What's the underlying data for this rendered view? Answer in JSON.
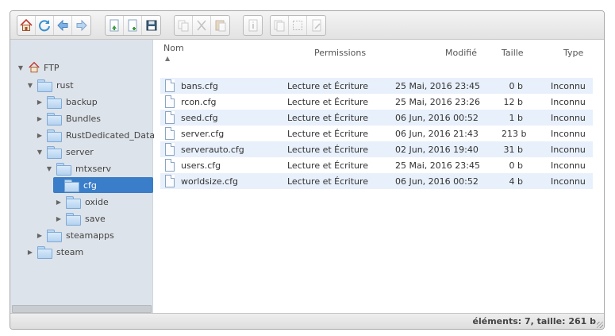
{
  "toolbar": {
    "groups": [
      [
        "home-icon",
        "reload-icon",
        "back-icon",
        "forward-icon"
      ],
      [
        "upload-icon",
        "new-file-icon",
        "save-icon"
      ],
      [
        "copy-icon",
        "cut-icon",
        "paste-icon"
      ],
      [
        "info-icon"
      ],
      [
        "duplicate-icon",
        "select-all-icon",
        "rename-icon"
      ]
    ]
  },
  "tree": {
    "root": "FTP",
    "rust": "rust",
    "backup": "backup",
    "bundles": "Bundles",
    "rustdedicated": "RustDedicated_Data",
    "server": "server",
    "mtxserv": "mtxserv",
    "cfg": "cfg",
    "oxide": "oxide",
    "save": "save",
    "steamapps": "steamapps",
    "steam": "steam"
  },
  "columns": {
    "name": "Nom",
    "permissions": "Permissions",
    "modified": "Modifié",
    "size": "Taille",
    "type": "Type"
  },
  "files": [
    {
      "name": "bans.cfg",
      "perm": "Lecture et Écriture",
      "date": "25 Mai, 2016 23:45",
      "size": "0 b",
      "type": "Inconnu"
    },
    {
      "name": "rcon.cfg",
      "perm": "Lecture et Écriture",
      "date": "25 Mai, 2016 23:26",
      "size": "12 b",
      "type": "Inconnu"
    },
    {
      "name": "seed.cfg",
      "perm": "Lecture et Écriture",
      "date": "06 Jun, 2016 00:52",
      "size": "1 b",
      "type": "Inconnu"
    },
    {
      "name": "server.cfg",
      "perm": "Lecture et Écriture",
      "date": "06 Jun, 2016 21:43",
      "size": "213 b",
      "type": "Inconnu"
    },
    {
      "name": "serverauto.cfg",
      "perm": "Lecture et Écriture",
      "date": "02 Jun, 2016 19:40",
      "size": "31 b",
      "type": "Inconnu"
    },
    {
      "name": "users.cfg",
      "perm": "Lecture et Écriture",
      "date": "25 Mai, 2016 23:45",
      "size": "0 b",
      "type": "Inconnu"
    },
    {
      "name": "worldsize.cfg",
      "perm": "Lecture et Écriture",
      "date": "06 Jun, 2016 00:52",
      "size": "4 b",
      "type": "Inconnu"
    }
  ],
  "status": "éléments: 7, taille: 261 b",
  "colors": {
    "selected": "#3a7dc9",
    "row_alt": "#e8f0fb",
    "tree_bg": "#dde3ea"
  }
}
